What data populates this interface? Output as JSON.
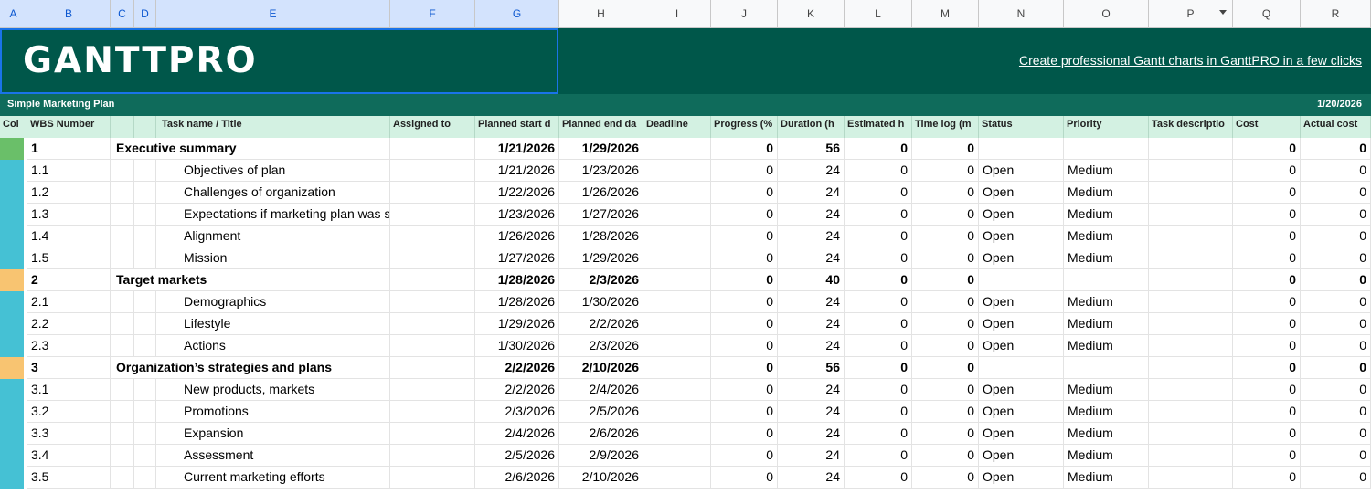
{
  "sheet": {
    "column_letters": [
      "A",
      "B",
      "C",
      "D",
      "E",
      "F",
      "G",
      "H",
      "I",
      "J",
      "K",
      "L",
      "M",
      "N",
      "O",
      "P",
      "Q",
      "R"
    ],
    "selected_columns": [
      "A",
      "B",
      "C",
      "D",
      "E",
      "F",
      "G"
    ],
    "dropdown_column": "P"
  },
  "banner": {
    "logo_text": "GANTTPRO",
    "promo_link": "Create professional Gantt charts in GanttPRO in a few clicks"
  },
  "plan": {
    "title": "Simple Marketing Plan",
    "date": "1/20/2026"
  },
  "headers": [
    "Col",
    "WBS Number",
    "",
    "",
    "Task name / Title",
    "Assigned to",
    "Planned start d",
    "Planned end da",
    "Deadline",
    "Progress (%",
    "Duration (h",
    "Estimated h",
    "Time log (m",
    "Status",
    "Priority",
    "Task descriptio",
    "Cost",
    "Actual cost"
  ],
  "colors": {
    "banner": "#00574a",
    "titlebar": "#0f6b5b",
    "header_bg": "#d3f1e2",
    "swatch_summary": "#6abf69",
    "swatch_section": "#f8c471",
    "swatch_task": "#45c1d4"
  },
  "rows": [
    {
      "color": "#6abf69",
      "wbs": "1",
      "task": "Executive summary",
      "assigned": "",
      "start": "1/21/2026",
      "end": "1/29/2026",
      "deadline": "",
      "progress": "0",
      "duration": "56",
      "estimated": "0",
      "timelog": "0",
      "status": "",
      "priority": "",
      "description": "",
      "cost": "0",
      "actual": "0",
      "parent": true
    },
    {
      "color": "#45c1d4",
      "wbs": "1.1",
      "task": "Objectives of plan",
      "assigned": "",
      "start": "1/21/2026",
      "end": "1/23/2026",
      "deadline": "",
      "progress": "0",
      "duration": "24",
      "estimated": "0",
      "timelog": "0",
      "status": "Open",
      "priority": "Medium",
      "description": "",
      "cost": "0",
      "actual": "0",
      "parent": false
    },
    {
      "color": "#45c1d4",
      "wbs": "1.2",
      "task": "Challenges of organization",
      "assigned": "",
      "start": "1/22/2026",
      "end": "1/26/2026",
      "deadline": "",
      "progress": "0",
      "duration": "24",
      "estimated": "0",
      "timelog": "0",
      "status": "Open",
      "priority": "Medium",
      "description": "",
      "cost": "0",
      "actual": "0",
      "parent": false
    },
    {
      "color": "#45c1d4",
      "wbs": "1.3",
      "task": "Expectations if marketing plan was successful",
      "assigned": "",
      "start": "1/23/2026",
      "end": "1/27/2026",
      "deadline": "",
      "progress": "0",
      "duration": "24",
      "estimated": "0",
      "timelog": "0",
      "status": "Open",
      "priority": "Medium",
      "description": "",
      "cost": "0",
      "actual": "0",
      "parent": false
    },
    {
      "color": "#45c1d4",
      "wbs": "1.4",
      "task": "Alignment",
      "assigned": "",
      "start": "1/26/2026",
      "end": "1/28/2026",
      "deadline": "",
      "progress": "0",
      "duration": "24",
      "estimated": "0",
      "timelog": "0",
      "status": "Open",
      "priority": "Medium",
      "description": "",
      "cost": "0",
      "actual": "0",
      "parent": false
    },
    {
      "color": "#45c1d4",
      "wbs": "1.5",
      "task": "Mission",
      "assigned": "",
      "start": "1/27/2026",
      "end": "1/29/2026",
      "deadline": "",
      "progress": "0",
      "duration": "24",
      "estimated": "0",
      "timelog": "0",
      "status": "Open",
      "priority": "Medium",
      "description": "",
      "cost": "0",
      "actual": "0",
      "parent": false
    },
    {
      "color": "#f8c471",
      "wbs": "2",
      "task": "Target markets",
      "assigned": "",
      "start": "1/28/2026",
      "end": "2/3/2026",
      "deadline": "",
      "progress": "0",
      "duration": "40",
      "estimated": "0",
      "timelog": "0",
      "status": "",
      "priority": "",
      "description": "",
      "cost": "0",
      "actual": "0",
      "parent": true
    },
    {
      "color": "#45c1d4",
      "wbs": "2.1",
      "task": "Demographics",
      "assigned": "",
      "start": "1/28/2026",
      "end": "1/30/2026",
      "deadline": "",
      "progress": "0",
      "duration": "24",
      "estimated": "0",
      "timelog": "0",
      "status": "Open",
      "priority": "Medium",
      "description": "",
      "cost": "0",
      "actual": "0",
      "parent": false
    },
    {
      "color": "#45c1d4",
      "wbs": "2.2",
      "task": "Lifestyle",
      "assigned": "",
      "start": "1/29/2026",
      "end": "2/2/2026",
      "deadline": "",
      "progress": "0",
      "duration": "24",
      "estimated": "0",
      "timelog": "0",
      "status": "Open",
      "priority": "Medium",
      "description": "",
      "cost": "0",
      "actual": "0",
      "parent": false
    },
    {
      "color": "#45c1d4",
      "wbs": "2.3",
      "task": "Actions",
      "assigned": "",
      "start": "1/30/2026",
      "end": "2/3/2026",
      "deadline": "",
      "progress": "0",
      "duration": "24",
      "estimated": "0",
      "timelog": "0",
      "status": "Open",
      "priority": "Medium",
      "description": "",
      "cost": "0",
      "actual": "0",
      "parent": false
    },
    {
      "color": "#f8c471",
      "wbs": "3",
      "task": "Organization’s strategies and plans",
      "assigned": "",
      "start": "2/2/2026",
      "end": "2/10/2026",
      "deadline": "",
      "progress": "0",
      "duration": "56",
      "estimated": "0",
      "timelog": "0",
      "status": "",
      "priority": "",
      "description": "",
      "cost": "0",
      "actual": "0",
      "parent": true
    },
    {
      "color": "#45c1d4",
      "wbs": "3.1",
      "task": "New products, markets",
      "assigned": "",
      "start": "2/2/2026",
      "end": "2/4/2026",
      "deadline": "",
      "progress": "0",
      "duration": "24",
      "estimated": "0",
      "timelog": "0",
      "status": "Open",
      "priority": "Medium",
      "description": "",
      "cost": "0",
      "actual": "0",
      "parent": false
    },
    {
      "color": "#45c1d4",
      "wbs": "3.2",
      "task": "Promotions",
      "assigned": "",
      "start": "2/3/2026",
      "end": "2/5/2026",
      "deadline": "",
      "progress": "0",
      "duration": "24",
      "estimated": "0",
      "timelog": "0",
      "status": "Open",
      "priority": "Medium",
      "description": "",
      "cost": "0",
      "actual": "0",
      "parent": false
    },
    {
      "color": "#45c1d4",
      "wbs": "3.3",
      "task": "Expansion",
      "assigned": "",
      "start": "2/4/2026",
      "end": "2/6/2026",
      "deadline": "",
      "progress": "0",
      "duration": "24",
      "estimated": "0",
      "timelog": "0",
      "status": "Open",
      "priority": "Medium",
      "description": "",
      "cost": "0",
      "actual": "0",
      "parent": false
    },
    {
      "color": "#45c1d4",
      "wbs": "3.4",
      "task": "Assessment",
      "assigned": "",
      "start": "2/5/2026",
      "end": "2/9/2026",
      "deadline": "",
      "progress": "0",
      "duration": "24",
      "estimated": "0",
      "timelog": "0",
      "status": "Open",
      "priority": "Medium",
      "description": "",
      "cost": "0",
      "actual": "0",
      "parent": false
    },
    {
      "color": "#45c1d4",
      "wbs": "3.5",
      "task": "Current marketing efforts",
      "assigned": "",
      "start": "2/6/2026",
      "end": "2/10/2026",
      "deadline": "",
      "progress": "0",
      "duration": "24",
      "estimated": "0",
      "timelog": "0",
      "status": "Open",
      "priority": "Medium",
      "description": "",
      "cost": "0",
      "actual": "0",
      "parent": false
    }
  ]
}
